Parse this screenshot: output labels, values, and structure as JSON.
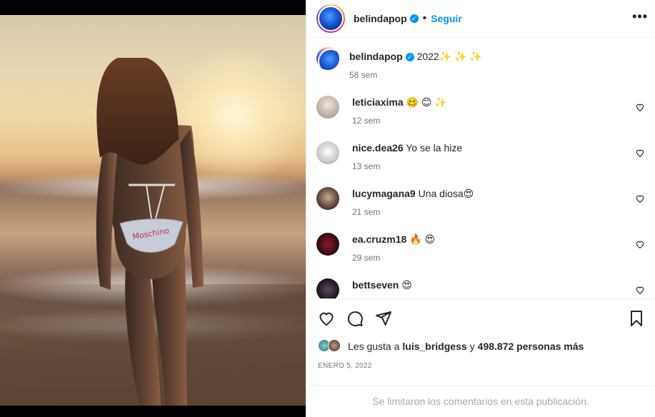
{
  "post": {
    "author": "belindapop",
    "follow_label": "Seguir",
    "separator": "•",
    "more_label": "•••"
  },
  "caption": {
    "username": "belindapop",
    "text": "2022✨ ✨ ✨",
    "time": "58 sem"
  },
  "comments": [
    {
      "username": "leticiaxima",
      "text": "🥴 😊 ✨",
      "time": "12 sem"
    },
    {
      "username": "nice.dea26",
      "text": "Yo se la hize",
      "time": "13 sem"
    },
    {
      "username": "lucymagana9",
      "text": "Una diosa😍",
      "time": "21 sem"
    },
    {
      "username": "ea.cruzm18",
      "text": "🔥 😍",
      "time": "29 sem"
    },
    {
      "username": "bettseven",
      "text": "😍",
      "time": ""
    }
  ],
  "likes": {
    "prefix": "Les gusta a",
    "user": "luis_bridgess",
    "joiner": "y",
    "count": "498.872 personas más"
  },
  "date": "ENERO 5, 2022",
  "footer": "Se limitaron los comentarios en esta publicación.",
  "icons": [
    "heart-icon",
    "comment-icon",
    "share-icon",
    "bookmark-icon",
    "more-icon",
    "verified-badge-icon"
  ],
  "colors": {
    "accent": "#0095f6",
    "muted": "#737373",
    "border": "#efefef"
  }
}
